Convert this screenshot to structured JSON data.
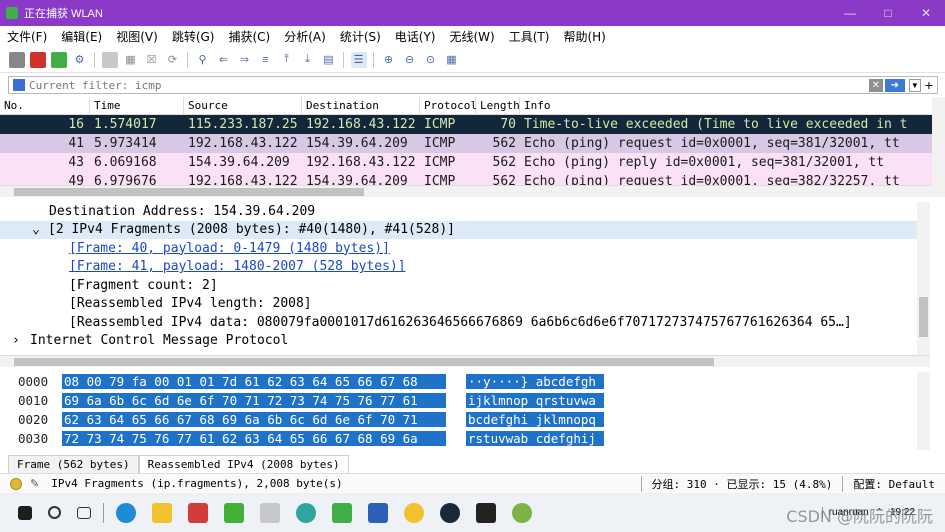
{
  "window": {
    "title": "正在捕获 WLAN"
  },
  "menu": [
    "文件(F)",
    "编辑(E)",
    "视图(V)",
    "跳转(G)",
    "捕获(C)",
    "分析(A)",
    "统计(S)",
    "电话(Y)",
    "无线(W)",
    "工具(T)",
    "帮助(H)"
  ],
  "filter": {
    "placeholder": "Current filter: icmp"
  },
  "columns": [
    "No.",
    "Time",
    "Source",
    "Destination",
    "Protocol",
    "Length",
    "Info"
  ],
  "packets": [
    {
      "no": "16",
      "time": "1.574017",
      "src": "115.233.187.25",
      "dst": "192.168.43.122",
      "proto": "ICMP",
      "len": "70",
      "info": "Time-to-live exceeded (Time to live exceeded in t"
    },
    {
      "no": "41",
      "time": "5.973414",
      "src": "192.168.43.122",
      "dst": "154.39.64.209",
      "proto": "ICMP",
      "len": "562",
      "info": "Echo (ping) request  id=0x0001, seq=381/32001, tt"
    },
    {
      "no": "43",
      "time": "6.069168",
      "src": "154.39.64.209",
      "dst": "192.168.43.122",
      "proto": "ICMP",
      "len": "562",
      "info": "Echo (ping) reply    id=0x0001, seq=381/32001, tt"
    },
    {
      "no": "49",
      "time": "6.979676",
      "src": "192.168.43.122",
      "dst": "154.39.64.209",
      "proto": "ICMP",
      "len": "562",
      "info": "Echo (ping) request  id=0x0001, seq=382/32257, tt"
    }
  ],
  "details": {
    "dest": "Destination Address: 154.39.64.209",
    "frag": "[2 IPv4 Fragments (2008 bytes): #40(1480), #41(528)]",
    "f40": "[Frame: 40, payload: 0-1479 (1480 bytes)]",
    "f41": "[Frame: 41, payload: 1480-2007 (528 bytes)]",
    "count": "[Fragment count: 2]",
    "rlen": "[Reassembled IPv4 length: 2008]",
    "rdata": "[Reassembled IPv4 data: 080079fa0001017d616263646566676869 6a6b6c6d6e6f707172737475767761626364 65…]",
    "icmp": "Internet Control Message Protocol"
  },
  "bytes": [
    {
      "off": "0000",
      "hex": "08 00 79 fa 00 01 01 7d  61 62 63 64 65 66 67 68",
      "ascii": "··y····} abcdefgh"
    },
    {
      "off": "0010",
      "hex": "69 6a 6b 6c 6d 6e 6f 70  71 72 73 74 75 76 77 61",
      "ascii": "ijklmnop qrstuvwa"
    },
    {
      "off": "0020",
      "hex": "62 63 64 65 66 67 68 69  6a 6b 6c 6d 6e 6f 70 71",
      "ascii": "bcdefghi jklmnopq"
    },
    {
      "off": "0030",
      "hex": "72 73 74 75 76 77 61 62  63 64 65 66 67 68 69 6a",
      "ascii": "rstuvwab cdefghij"
    }
  ],
  "byte_tabs": [
    "Frame (562 bytes)",
    "Reassembled IPv4 (2008 bytes)"
  ],
  "status": {
    "field": "IPv4 Fragments (ip.fragments), 2,008 byte(s)",
    "groups": "分组: 310 · 已显示: 15 (4.8%)",
    "profile": "配置: Default"
  },
  "taskbar": {
    "user": "ruanruan",
    "time": "19:22"
  },
  "watermark": "CSDN @阮阮的阮阮"
}
